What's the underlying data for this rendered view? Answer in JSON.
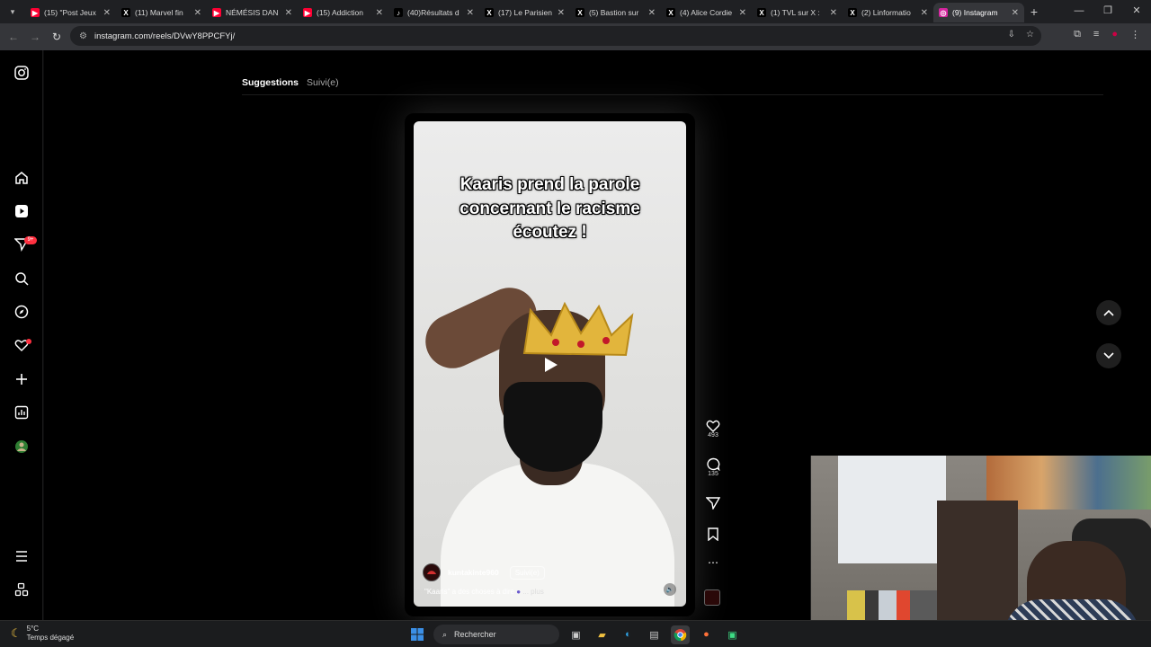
{
  "browser": {
    "tabs": [
      {
        "title": "(15) \"Post Jeux",
        "color": "#ff0033",
        "glyph": "▶"
      },
      {
        "title": "(11) Marvel fin",
        "color": "#000000",
        "glyph": "X"
      },
      {
        "title": "NÉMÉSIS DAN",
        "color": "#ff0033",
        "glyph": "▶"
      },
      {
        "title": "(15) Addiction",
        "color": "#ff0033",
        "glyph": "▶"
      },
      {
        "title": "(40)Résultats d",
        "color": "#000000",
        "glyph": "♪"
      },
      {
        "title": "(17) Le Parisien",
        "color": "#000000",
        "glyph": "X"
      },
      {
        "title": "(5) Bastion sur",
        "color": "#000000",
        "glyph": "X"
      },
      {
        "title": "(4) Alice Cordie",
        "color": "#000000",
        "glyph": "X"
      },
      {
        "title": "(1) TVL sur X :",
        "color": "#000000",
        "glyph": "X"
      },
      {
        "title": "(2) Linformatio",
        "color": "#000000",
        "glyph": "X"
      },
      {
        "title": "(9) Instagram",
        "color": "#d6249f",
        "glyph": "◎",
        "active": true
      }
    ],
    "url": "instagram.com/reels/DVwY8PPCFYj/"
  },
  "feed_tabs": {
    "suggestions": "Suggestions",
    "following": "Suivi(e)"
  },
  "reel": {
    "caption_lines": [
      "Kaaris prend la parole",
      "concernant le racisme",
      "écoutez !"
    ],
    "username": "kuntakinte960",
    "follow_label": "Suivi(e)",
    "description": "\"Kaaris\" a des choses à dire",
    "more": "... plus"
  },
  "actions": {
    "likes": "493",
    "comments": "135"
  },
  "notifications_badge": "9+",
  "taskbar": {
    "temp": "5°C",
    "weather": "Temps dégagé",
    "search_placeholder": "Rechercher"
  }
}
